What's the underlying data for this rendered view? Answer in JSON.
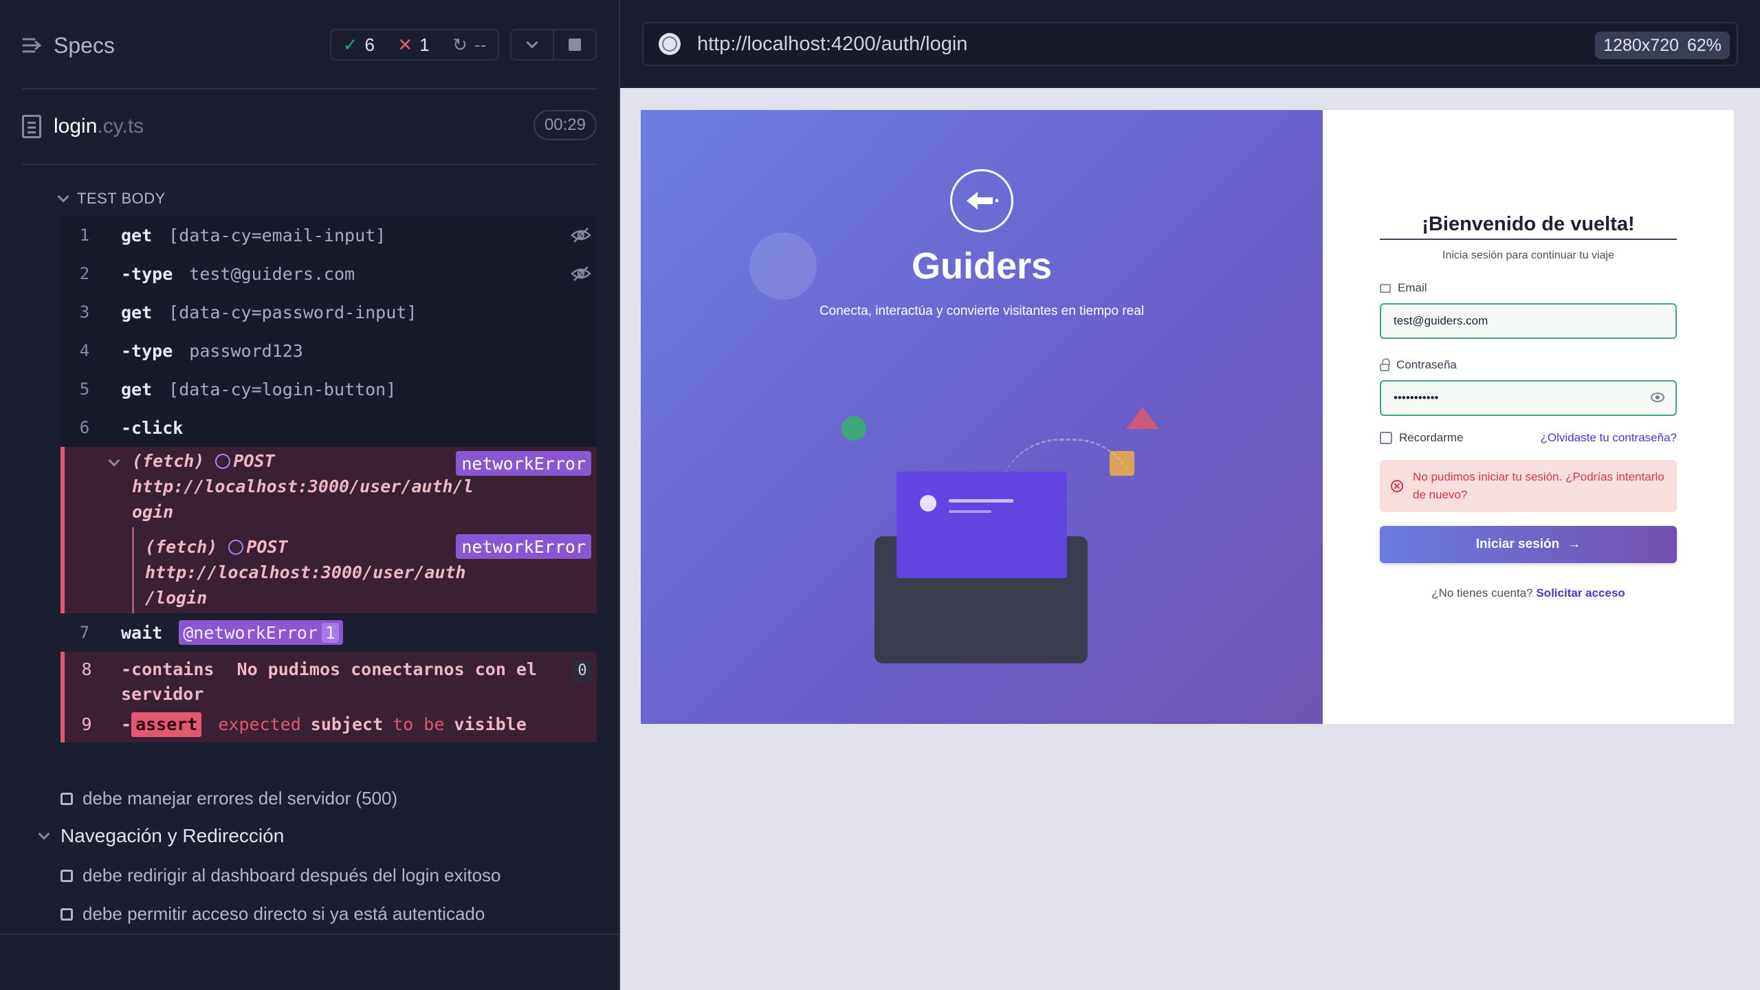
{
  "reporter": {
    "title": "Specs",
    "stats": {
      "passed": "6",
      "failed": "1",
      "pending": "--"
    },
    "file": {
      "name": "login",
      "ext": ".cy.ts",
      "duration": "00:29"
    },
    "section_label": "TEST BODY",
    "commands": [
      {
        "num": "1",
        "name": "get",
        "arg": "[data-cy=email-input]"
      },
      {
        "num": "2",
        "name": "-type",
        "arg": "test@guiders.com"
      },
      {
        "num": "3",
        "name": "get",
        "arg": "[data-cy=password-input]"
      },
      {
        "num": "4",
        "name": "-type",
        "arg": "password123"
      },
      {
        "num": "5",
        "name": "get",
        "arg": "[data-cy=login-button]"
      },
      {
        "num": "6",
        "name": "-click",
        "arg": ""
      }
    ],
    "fetch": {
      "kind": "(fetch)",
      "method": "POST",
      "url_line1": "http://localhost:3000/user/auth/l",
      "url_line2": "ogin",
      "badge": "networkError",
      "sub_url_line1": "http://localhost:3000/user/auth",
      "sub_url_line2": "/login"
    },
    "wait": {
      "num": "7",
      "name": "wait",
      "alias": "@networkError",
      "count": "1"
    },
    "contains": {
      "num": "8",
      "name": "-contains",
      "text_line1": "No pudimos conectarnos con el",
      "text_line2": "servidor",
      "count": "0"
    },
    "assert": {
      "num": "9",
      "badge": "assert",
      "w1": "expected",
      "w2": "subject",
      "w3": "to be",
      "w4": "visible"
    },
    "tests": [
      "debe manejar errores del servidor (500)"
    ],
    "suite": "Navegación y Redirección",
    "suite_tests": [
      "debe redirigir al dashboard después del login exitoso",
      "debe permitir acceso directo si ya está autenticado"
    ]
  },
  "browser": {
    "url": "http://localhost:4200/auth/login",
    "resolution": "1280x720",
    "zoom": "62%"
  },
  "app": {
    "hero_title": "Guiders",
    "hero_subtitle": "Conecta, interactúa y convierte visitantes en tiempo real",
    "form_title": "¡Bienvenido de vuelta!",
    "form_subtitle": "Inicia sesión para continuar tu viaje",
    "email_label": "Email",
    "email_value": "test@guiders.com",
    "password_label": "Contraseña",
    "password_value": "•••••••••••",
    "remember_label": "Recordarme",
    "forgot_link": "¿Olvidaste tu contraseña?",
    "error_message": "No pudimos iniciar tu sesión. ¿Podrías intentarlo de nuevo?",
    "submit_label": "Iniciar sesión",
    "signup_prompt": "¿No tienes cuenta?",
    "signup_link": "Solicitar acceso"
  },
  "colors": {
    "reporter_bg": "#1b1e2e",
    "fail_bg": "#3a2032",
    "fail_accent": "#e45770",
    "alias_purple": "#8a56d1",
    "hero_gradient_start": "#6b7fe0",
    "hero_gradient_end": "#6f56b4",
    "input_border_success": "#3fa67c",
    "error_text": "#d63546"
  }
}
